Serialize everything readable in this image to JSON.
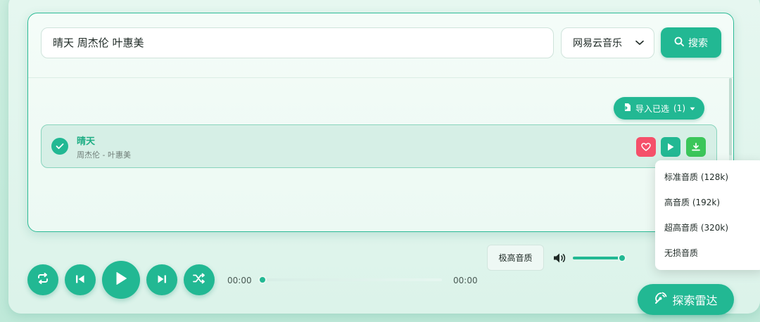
{
  "search": {
    "query": "晴天 周杰伦 叶惠美",
    "source": "网易云音乐",
    "button_label": "搜索"
  },
  "import_button": {
    "label": "导入已选",
    "count": "(1)"
  },
  "results": [
    {
      "title": "晴天",
      "artist": "周杰伦 - 叶惠美",
      "selected": true
    }
  ],
  "player": {
    "current_time": "00:00",
    "total_time": "00:00",
    "progress": 0,
    "quality_label": "极高音质",
    "volume": 0.95
  },
  "quality_menu": {
    "options": [
      "标准音质 (128k)",
      "高音质 (192k)",
      "超高音质 (320k)",
      "无损音质"
    ]
  },
  "radar_button": {
    "label": "探索雷达"
  },
  "colors": {
    "accent": "#22b893",
    "favorite": "#f5506a",
    "download": "#3bc65a"
  },
  "icons": {
    "search_button": "search-icon",
    "import": "import-icon",
    "select": "chevron-down-icon",
    "check": "check-icon",
    "favorite": "heart-icon",
    "play": "play-icon",
    "download": "download-icon",
    "repeat": "repeat-icon",
    "previous": "skip-previous-icon",
    "next": "skip-next-icon",
    "shuffle": "shuffle-icon",
    "volume": "volume-icon",
    "radar": "radar-icon"
  }
}
